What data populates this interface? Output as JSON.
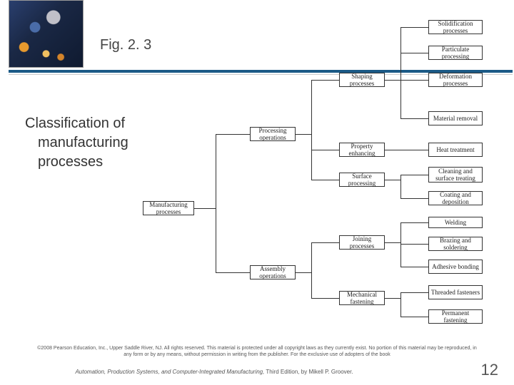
{
  "header": {
    "fig_label": "Fig. 2. 3"
  },
  "subtitle": "Classification of manufacturing processes",
  "nodes": {
    "root": "Manufacturing processes",
    "l1": {
      "a": "Processing operations",
      "b": "Assembly operations"
    },
    "l2": {
      "a": "Shaping processes",
      "b": "Property enhancing",
      "c": "Surface processing",
      "d": "Joining processes",
      "e": "Mechanical fastening"
    },
    "l3": {
      "a": "Solidification processes",
      "b": "Particulate processing",
      "c": "Deformation processes",
      "d": "Material removal",
      "e": "Heat treatment",
      "f": "Cleaning and surface treating",
      "g": "Coating and deposition",
      "h": "Welding",
      "i": "Brazing and soldering",
      "j": "Adhesive bonding",
      "k": "Threaded fasteners",
      "l": "Permanent fastening"
    }
  },
  "copyright": "©2008 Pearson Education, Inc., Upper Saddle River, NJ. All rights reserved. This material is protected under all copyright laws as they currently exist. No portion of this material may be reproduced, in any form or by any means, without permission in writing from the publisher. For the exclusive use of adopters of the book",
  "bookline_italic": "Automation, Production Systems, and Computer-Integrated Manufacturing,",
  "bookline_rest": " Third Edition, by Mikell P. Groover.",
  "page_number": "12"
}
